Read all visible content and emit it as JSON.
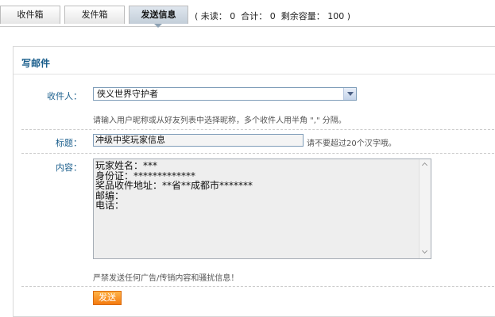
{
  "tabs": [
    {
      "label": "收件箱",
      "active": false
    },
    {
      "label": "发件箱",
      "active": false
    },
    {
      "label": "发送信息",
      "active": true
    }
  ],
  "stats": {
    "open": "(",
    "unread_label": "未读：",
    "unread": "0",
    "total_label": "合计：",
    "total": "0",
    "capacity_label": "剩余容量：",
    "capacity": "100",
    "close": ")"
  },
  "compose": {
    "title": "写邮件",
    "recipient_label": "收件人：",
    "recipient_value": "侠义世界守护者",
    "recipient_hint": "请输入用户昵称或从好友列表中选择昵称，多个收件人用半角 \",\" 分隔。",
    "subject_label": "标题：",
    "subject_value": "冲级中奖玩家信息",
    "subject_hint": "请不要超过20个汉字哦。",
    "content_label": "内容：",
    "content_lines": [
      "玩家姓名：***",
      "身份证：*************",
      "奖品收件地址：**省**成都市*******",
      "邮编：",
      "电话："
    ],
    "warning": "严禁发送任何广告/传销内容和骚扰信息！",
    "send_label": "发送"
  },
  "colors": {
    "label_blue": "#1a5e8c",
    "send_orange": "#f47b10"
  }
}
